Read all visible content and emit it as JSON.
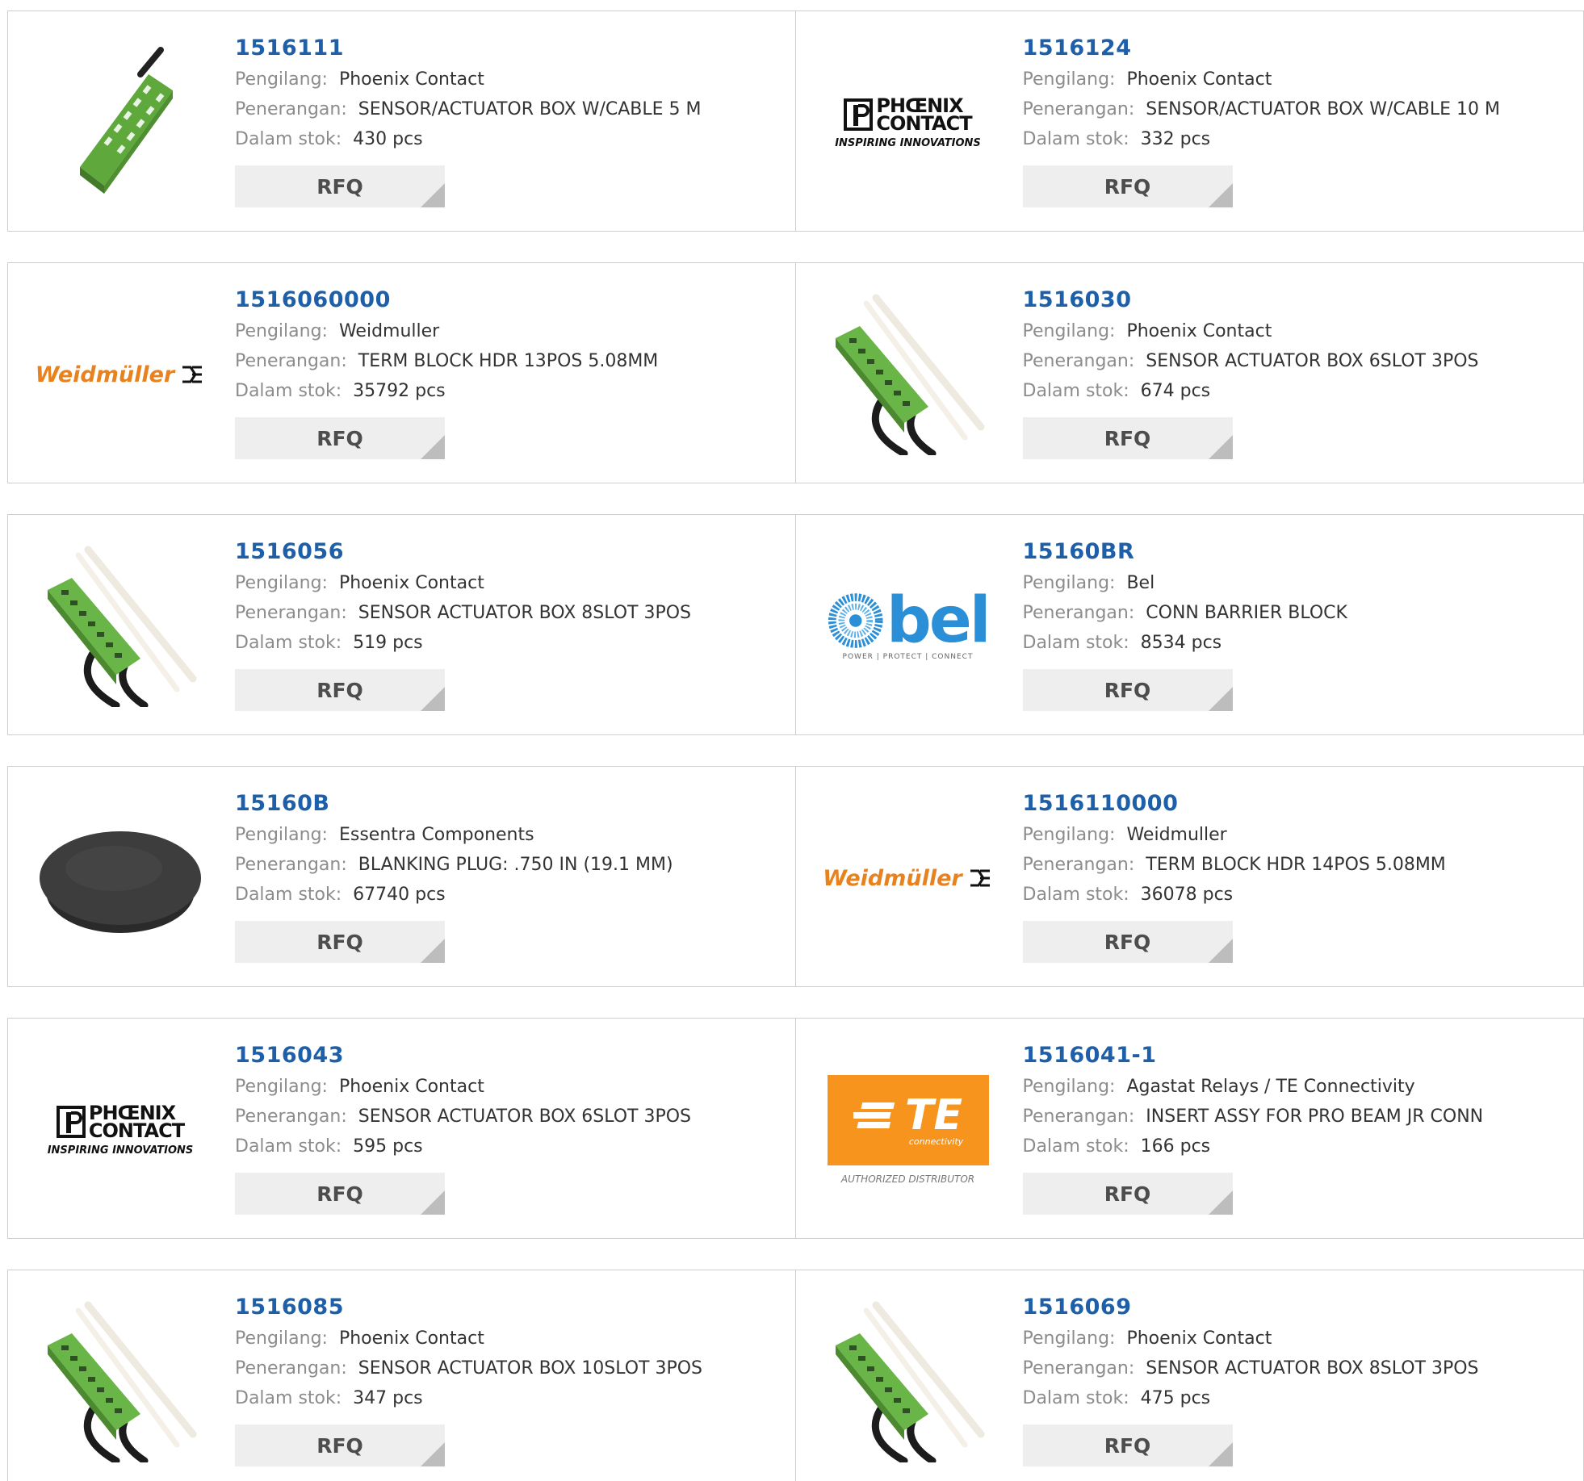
{
  "labels": {
    "manufacturer": "Pengilang:",
    "description": "Penerangan:",
    "stock": "Dalam stok:",
    "rfq": "RFQ"
  },
  "logos": {
    "phoenix_line1": "PHŒNIX",
    "phoenix_line2": "CONTACT",
    "phoenix_tagline": "INSPIRING INNOVATIONS",
    "weidmuller": "Weidmüller",
    "bel": "bel",
    "bel_tagline": "POWER | PROTECT | CONNECT",
    "te": "TE",
    "te_sub": "connectivity",
    "te_tagline": "AUTHORIZED DISTRIBUTOR"
  },
  "products": [
    {
      "part": "1516111",
      "manufacturer": "Phoenix Contact",
      "description": "SENSOR/ACTUATOR BOX W/CABLE 5 M",
      "stock": "430 pcs",
      "image": "green-box-top"
    },
    {
      "part": "1516124",
      "manufacturer": "Phoenix Contact",
      "description": "SENSOR/ACTUATOR BOX W/CABLE 10 M",
      "stock": "332 pcs",
      "image": "phoenix-logo"
    },
    {
      "part": "1516060000",
      "manufacturer": "Weidmuller",
      "description": "TERM BLOCK HDR 13POS 5.08MM",
      "stock": "35792 pcs",
      "image": "weidmuller-logo"
    },
    {
      "part": "1516030",
      "manufacturer": "Phoenix Contact",
      "description": "SENSOR ACTUATOR BOX 6SLOT 3POS",
      "stock": "674 pcs",
      "image": "green-box-cable"
    },
    {
      "part": "1516056",
      "manufacturer": "Phoenix Contact",
      "description": "SENSOR ACTUATOR BOX 8SLOT 3POS",
      "stock": "519 pcs",
      "image": "green-box-cable"
    },
    {
      "part": "15160BR",
      "manufacturer": "Bel",
      "description": "CONN BARRIER BLOCK",
      "stock": "8534 pcs",
      "image": "bel-logo"
    },
    {
      "part": "15160B",
      "manufacturer": "Essentra Components",
      "description": "BLANKING PLUG: .750 IN (19.1 MM)",
      "stock": "67740 pcs",
      "image": "black-plug"
    },
    {
      "part": "1516110000",
      "manufacturer": "Weidmuller",
      "description": "TERM BLOCK HDR 14POS 5.08MM",
      "stock": "36078 pcs",
      "image": "weidmuller-logo"
    },
    {
      "part": "1516043",
      "manufacturer": "Phoenix Contact",
      "description": "SENSOR ACTUATOR BOX 6SLOT 3POS",
      "stock": "595 pcs",
      "image": "phoenix-logo"
    },
    {
      "part": "1516041-1",
      "manufacturer": "Agastat Relays / TE Connectivity",
      "description": "INSERT ASSY FOR PRO BEAM JR CONN",
      "stock": "166 pcs",
      "image": "te-logo"
    },
    {
      "part": "1516085",
      "manufacturer": "Phoenix Contact",
      "description": "SENSOR ACTUATOR BOX 10SLOT 3POS",
      "stock": "347 pcs",
      "image": "green-box-cable"
    },
    {
      "part": "1516069",
      "manufacturer": "Phoenix Contact",
      "description": "SENSOR ACTUATOR BOX 8SLOT 3POS",
      "stock": "475 pcs",
      "image": "green-box-cable"
    }
  ],
  "colors": {
    "part_link": "#1d5fa8",
    "label_gray": "#8c8c8c",
    "value_dark": "#333333",
    "rfq_bg": "#eeeeee",
    "weidmuller_orange": "#e8821e",
    "bel_blue": "#2a8fd6",
    "te_orange": "#f7941d",
    "green_box": "#6ab547"
  }
}
